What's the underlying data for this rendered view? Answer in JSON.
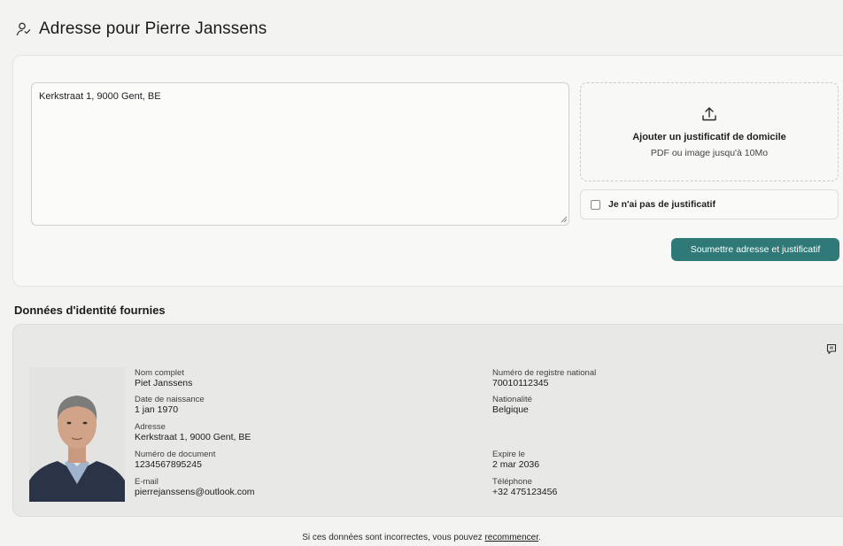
{
  "header": {
    "title": "Adresse pour Pierre Janssens",
    "icon": "user-address-icon"
  },
  "address_form": {
    "address_value": "Kerkstraat 1, 9000 Gent, BE",
    "dropzone": {
      "icon": "upload-icon",
      "title": "Ajouter un justificatif de domicile",
      "subtitle": "PDF ou image jusqu'à 10Mo"
    },
    "no_proof_label": "Je n'ai pas de justificatif",
    "submit_label": "Soumettre adresse et justificatif"
  },
  "identity": {
    "section_title": "Données d'identité fournies",
    "report_icon": "flag-report-icon",
    "left_fields": [
      {
        "label": "Nom complet",
        "value": "Piet Janssens"
      },
      {
        "label": "Date de naissance",
        "value": "1 jan 1970"
      },
      {
        "label": "Adresse",
        "value": "Kerkstraat 1, 9000 Gent, BE"
      },
      {
        "label": "Numéro de document",
        "value": "1234567895245"
      },
      {
        "label": "E-mail",
        "value": "pierrejanssens@outlook.com"
      }
    ],
    "right_fields": [
      {
        "label": "Numéro de registre national",
        "value": "70010112345"
      },
      {
        "label": "Nationalité",
        "value": "Belgique"
      },
      {
        "label": "Expire le",
        "value": "2 mar 2036"
      },
      {
        "label": "Téléphone",
        "value": "+32 475123456"
      }
    ]
  },
  "footer": {
    "text_before": "Si ces données sont incorrectes, vous pouvez ",
    "link": "recommencer",
    "text_after": "."
  },
  "colors": {
    "accent": "#2f7a78",
    "background": "#f3f3f1",
    "card": "#e8e9e6"
  }
}
